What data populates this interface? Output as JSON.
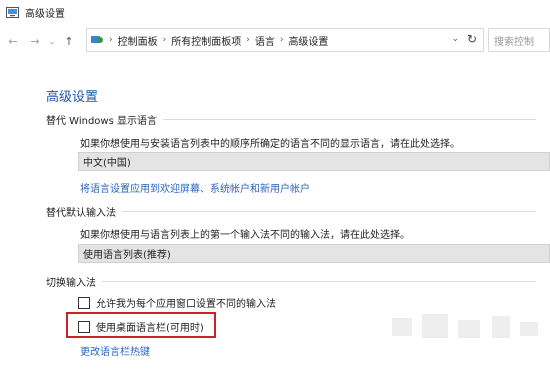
{
  "window": {
    "title": "高级设置"
  },
  "nav": {
    "back": "←",
    "forward": "→",
    "recent": "⌄",
    "up": "↑",
    "breadcrumb": [
      "控制面板",
      "所有控制面板项",
      "语言",
      "高级设置"
    ],
    "separator": "›",
    "dropdown": "⌄",
    "refresh": "↻",
    "search_placeholder": "搜索控制"
  },
  "page": {
    "title": "高级设置"
  },
  "display_language": {
    "heading": "替代 Windows 显示语言",
    "description": "如果你想使用与安装语言列表中的顺序所确定的语言不同的显示语言，请在此处选择。",
    "selected": "中文(中国)",
    "link": "将语言设置应用到欢迎屏幕、系统帐户和新用户帐户"
  },
  "input_method": {
    "heading": "替代默认输入法",
    "description": "如果你想使用与语言列表上的第一个输入法不同的输入法，请在此处选择。",
    "selected": "使用语言列表(推荐)"
  },
  "switch_input": {
    "heading": "切换输入法",
    "options": [
      {
        "label": "允许我为每个应用窗口设置不同的输入法",
        "checked": false
      },
      {
        "label": "使用桌面语言栏(可用时)",
        "checked": false
      }
    ],
    "link": "更改语言栏热键"
  },
  "colors": {
    "accent": "#1e5aa8",
    "link": "#2a66c0",
    "highlight": "#c8232c"
  },
  "icons": [
    "control-panel-icon",
    "back-arrow-icon",
    "forward-arrow-icon",
    "up-arrow-icon",
    "location-icon",
    "refresh-icon"
  ]
}
